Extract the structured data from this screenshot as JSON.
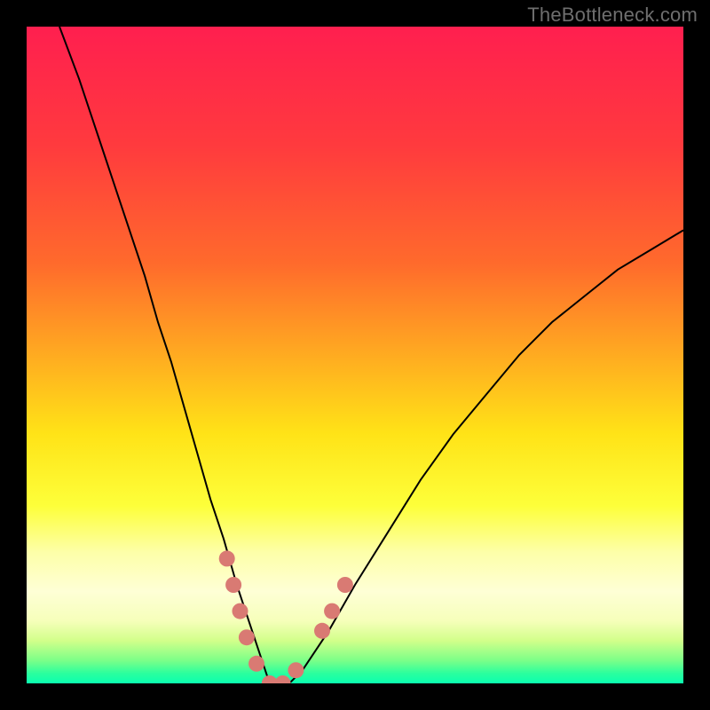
{
  "attribution": "TheBottleneck.com",
  "chart_data": {
    "type": "line",
    "title": "",
    "xlabel": "",
    "ylabel": "",
    "xlim": [
      0,
      100
    ],
    "ylim": [
      0,
      100
    ],
    "grid": false,
    "legend": false,
    "background_gradient": {
      "orientation": "vertical",
      "stops": [
        {
          "offset": 0.0,
          "color": "#ff1f4f"
        },
        {
          "offset": 0.18,
          "color": "#ff3a3e"
        },
        {
          "offset": 0.36,
          "color": "#ff6a2c"
        },
        {
          "offset": 0.52,
          "color": "#ffb41f"
        },
        {
          "offset": 0.62,
          "color": "#ffe317"
        },
        {
          "offset": 0.73,
          "color": "#fdff3a"
        },
        {
          "offset": 0.8,
          "color": "#fdffa8"
        },
        {
          "offset": 0.86,
          "color": "#feffd6"
        },
        {
          "offset": 0.905,
          "color": "#f6ffba"
        },
        {
          "offset": 0.935,
          "color": "#d2ff8a"
        },
        {
          "offset": 0.965,
          "color": "#7cff88"
        },
        {
          "offset": 0.985,
          "color": "#2aff9e"
        },
        {
          "offset": 1.0,
          "color": "#0affb0"
        }
      ]
    },
    "series": [
      {
        "name": "bottleneck-curve",
        "stroke": "#000000",
        "stroke_width": 2,
        "x": [
          5,
          8,
          10,
          12,
          14,
          16,
          18,
          20,
          22,
          24,
          26,
          28,
          30,
          32,
          34,
          36,
          37,
          38,
          40,
          42,
          46,
          50,
          55,
          60,
          65,
          70,
          75,
          80,
          85,
          90,
          95,
          100
        ],
        "y": [
          100,
          92,
          86,
          80,
          74,
          68,
          62,
          55,
          49,
          42,
          35,
          28,
          22,
          15,
          9,
          3,
          0,
          0,
          0,
          2,
          8,
          15,
          23,
          31,
          38,
          44,
          50,
          55,
          59,
          63,
          66,
          69
        ]
      }
    ],
    "markers": [
      {
        "name": "threshold-markers",
        "color": "#d97a73",
        "radius": 9,
        "points": [
          {
            "x": 30.5,
            "y": 19
          },
          {
            "x": 31.5,
            "y": 15
          },
          {
            "x": 32.5,
            "y": 11
          },
          {
            "x": 33.5,
            "y": 7
          },
          {
            "x": 35.0,
            "y": 3
          },
          {
            "x": 37.0,
            "y": 0
          },
          {
            "x": 39.0,
            "y": 0
          },
          {
            "x": 41.0,
            "y": 2
          },
          {
            "x": 45.0,
            "y": 8
          },
          {
            "x": 46.5,
            "y": 11
          },
          {
            "x": 48.5,
            "y": 15
          }
        ]
      }
    ]
  }
}
